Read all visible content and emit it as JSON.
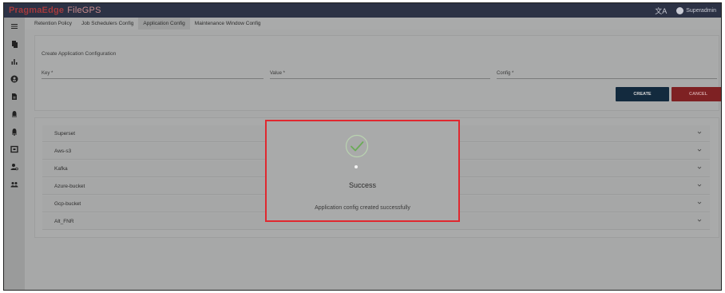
{
  "app": {
    "brand_primary": "PragmaEdge",
    "brand_secondary": "FileGPS"
  },
  "header": {
    "translate_icon": "translate-icon",
    "user_name": "Superadmin"
  },
  "tabs": [
    {
      "label": "Retention Policy"
    },
    {
      "label": "Job Schedulers Config"
    },
    {
      "label": "Application Config",
      "active": true
    },
    {
      "label": "Maintenance Window Config"
    }
  ],
  "form": {
    "title": "Create Application Configuration",
    "key_label": "Key *",
    "value_label": "Value *",
    "config_label": "Config *",
    "create_label": "CREATE",
    "cancel_label": "CANCEL"
  },
  "configs": [
    {
      "label": "Superset"
    },
    {
      "label": "Aws-s3"
    },
    {
      "label": "Kafka"
    },
    {
      "label": "Azure-bucket"
    },
    {
      "label": "Gcp-bucket"
    },
    {
      "label": "Alt_FNR"
    }
  ],
  "modal": {
    "title": "Success",
    "message": "Application config created successfully"
  },
  "colors": {
    "topbar": "#2c3245",
    "brand": "#a43a3d",
    "create_button": "#132a3e",
    "cancel_button": "#7e2123",
    "modal_border": "#e0282f",
    "success_check": "#6bab57"
  }
}
